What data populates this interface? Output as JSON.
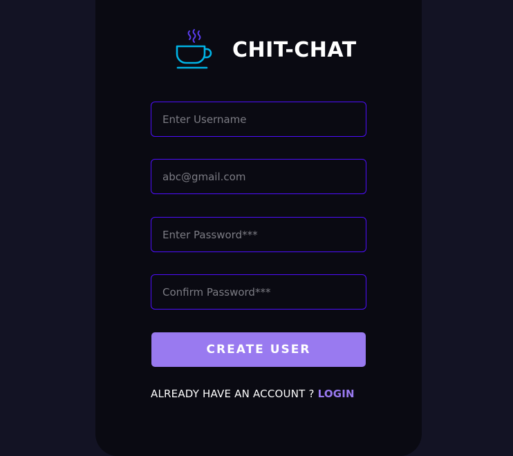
{
  "brand": {
    "title": "CHIT-CHAT",
    "logo_icon": "coffee-cup-icon"
  },
  "form": {
    "username": {
      "placeholder": "Enter Username",
      "value": ""
    },
    "email": {
      "placeholder": "abc@gmail.com",
      "value": ""
    },
    "password": {
      "placeholder": "Enter Password***",
      "value": ""
    },
    "confirm_password": {
      "placeholder": "Confirm Password***",
      "value": ""
    },
    "submit_label": "CREATE USER"
  },
  "footer": {
    "prompt": "ALREADY HAVE AN ACCOUNT ? ",
    "login_label": "LOGIN"
  },
  "colors": {
    "page_background": "#131324",
    "card_background": "#0a0a12",
    "field_border": "#4e0eff",
    "accent": "#997af0",
    "logo": "#00b4e6"
  }
}
